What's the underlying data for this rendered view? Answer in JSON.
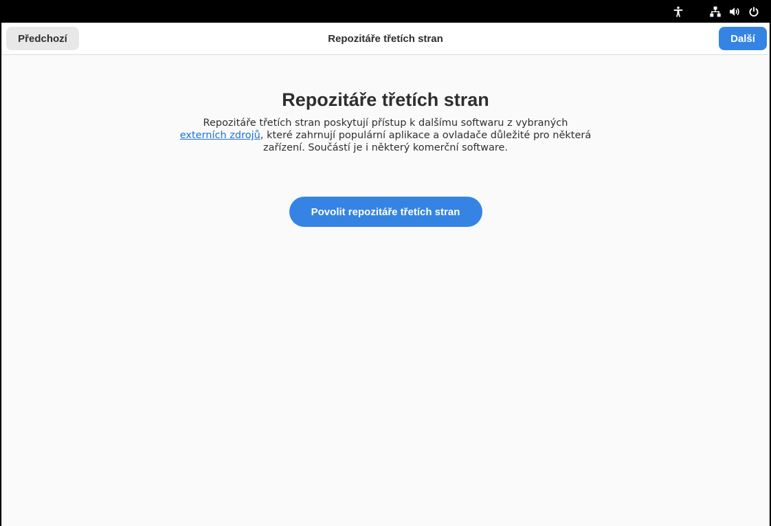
{
  "system_bar": {
    "icons": [
      "accessibility-icon",
      "network-wired-icon",
      "volume-icon",
      "power-icon"
    ]
  },
  "header": {
    "back_label": "Předchozí",
    "title": "Repozitáře třetích stran",
    "next_label": "Další"
  },
  "main": {
    "heading": "Repozitáře třetích stran",
    "description_before": "Repozitáře třetích stran poskytují přístup k dalšímu softwaru z vybraných ",
    "description_link": "externích zdrojů",
    "description_after": ", které zahrnují populární aplikace a ovladače důležité pro některá zařízení. Součástí je i některý komerční software.",
    "enable_button": "Povolit repozitáře třetích stran"
  },
  "colors": {
    "accent": "#3584e4",
    "link": "#1c71d8",
    "window_bg": "#fafafa",
    "header_bg": "#ffffff",
    "topbar_bg": "#000000"
  }
}
